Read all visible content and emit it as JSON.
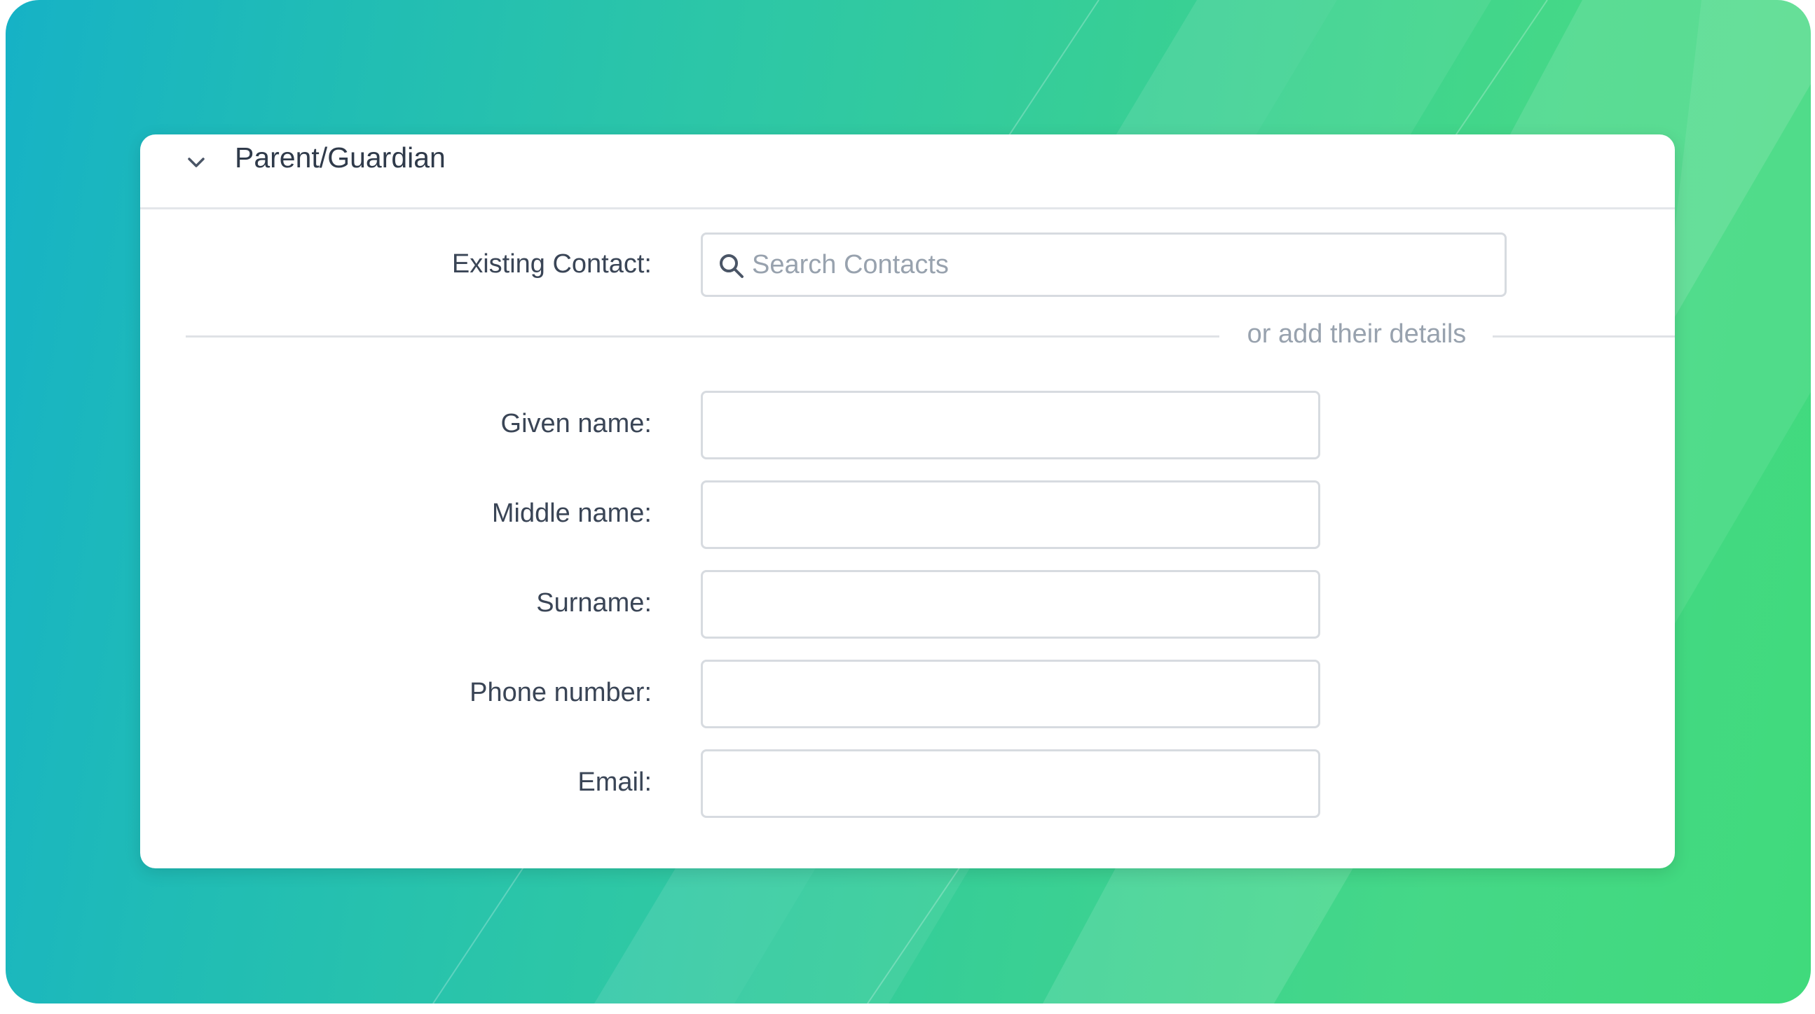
{
  "colors": {
    "accent_from": "#16b2c6",
    "accent_to": "#40da7c",
    "text": "#2f3a4a",
    "muted": "#98a2ae",
    "border": "#d7dbe0"
  },
  "section": {
    "title": "Parent/Guardian",
    "toggle_icon": "chevron-down-icon",
    "expanded": true
  },
  "existing_contact": {
    "label": "Existing Contact:",
    "placeholder": "Search Contacts",
    "icon": "search-icon"
  },
  "divider": {
    "text": "or add their details"
  },
  "fields": [
    {
      "label": "Given name:",
      "value": ""
    },
    {
      "label": "Middle name:",
      "value": ""
    },
    {
      "label": "Surname:",
      "value": ""
    },
    {
      "label": "Phone number:",
      "value": ""
    },
    {
      "label": "Email:",
      "value": ""
    }
  ]
}
